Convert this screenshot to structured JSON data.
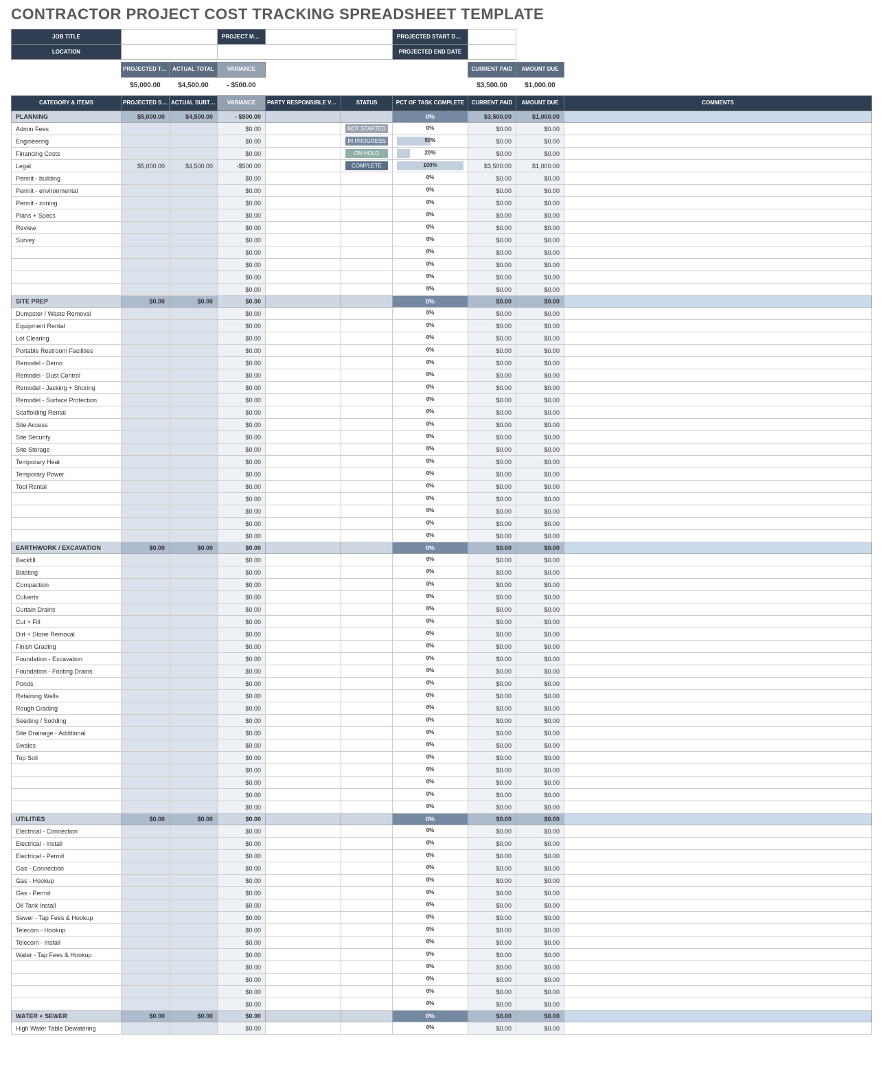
{
  "title": "CONTRACTOR PROJECT COST TRACKING SPREADSHEET TEMPLATE",
  "meta": {
    "job_title_label": "JOB TITLE",
    "location_label": "LOCATION",
    "project_mgr_label": "PROJECT MGR",
    "projected_start_label": "PROJECTED START DATE",
    "projected_end_label": "PROJECTED END DATE"
  },
  "summary_headers": {
    "projected_total": "PROJECTED\nTOTAL",
    "actual_total": "ACTUAL\nTOTAL",
    "variance": "VARIANCE",
    "current_paid": "CURRENT PAID",
    "amount_due": "AMOUNT DUE"
  },
  "summary_values": {
    "projected_total": "$5,000.00",
    "actual_total": "$4,500.00",
    "variance": "- $500.00",
    "current_paid": "$3,500.00",
    "amount_due": "$1,000.00"
  },
  "col_headers": {
    "category": "CATEGORY & ITEMS",
    "projected_subtotal": "PROJECTED\nSUBTOTAL",
    "actual_subtotal": "ACTUAL\nSUBTOTAL",
    "variance": "VARIANCE",
    "party": "PARTY RESPONSIBLE\nVendor, Contractor, etc.",
    "status": "STATUS",
    "pct": "PCT OF TASK COMPLETE",
    "current_paid": "CURRENT PAID",
    "amount_due": "AMOUNT DUE",
    "comments": "COMMENTS"
  },
  "status_labels": {
    "NOT_STARTED": "NOT STARTED",
    "IN_PROGRESS": "IN PROGRESS",
    "ON_HOLD": "ON HOLD",
    "COMPLETE": "COMPLETE"
  },
  "categories": [
    {
      "name": "PLANNING",
      "projected": "$5,000.00",
      "actual": "$4,500.00",
      "variance": "- $500.00",
      "pct": "0%",
      "paid": "$3,500.00",
      "due": "$1,000.00",
      "items": [
        {
          "name": "Admin Fees",
          "variance": "$0.00",
          "status": "NOT_STARTED",
          "pct": "0%",
          "pct_num": 0,
          "paid": "$0.00",
          "due": "$0.00"
        },
        {
          "name": "Engineering",
          "variance": "$0.00",
          "status": "IN_PROGRESS",
          "pct": "50%",
          "pct_num": 50,
          "paid": "$0.00",
          "due": "$0.00"
        },
        {
          "name": "Financing Costs",
          "variance": "$0.00",
          "status": "ON_HOLD",
          "pct": "20%",
          "pct_num": 20,
          "paid": "$0.00",
          "due": "$0.00"
        },
        {
          "name": "Legal",
          "projected": "$5,000.00",
          "actual": "$4,500.00",
          "variance": "-$500.00",
          "status": "COMPLETE",
          "pct": "100%",
          "pct_num": 100,
          "paid": "$3,500.00",
          "due": "$1,000.00"
        },
        {
          "name": "Permit - building",
          "variance": "$0.00",
          "pct": "0%",
          "pct_num": 0,
          "paid": "$0.00",
          "due": "$0.00"
        },
        {
          "name": "Permit - environmental",
          "variance": "$0.00",
          "pct": "0%",
          "pct_num": 0,
          "paid": "$0.00",
          "due": "$0.00"
        },
        {
          "name": "Permit - zoning",
          "variance": "$0.00",
          "pct": "0%",
          "pct_num": 0,
          "paid": "$0.00",
          "due": "$0.00"
        },
        {
          "name": "Plans + Specs",
          "variance": "$0.00",
          "pct": "0%",
          "pct_num": 0,
          "paid": "$0.00",
          "due": "$0.00"
        },
        {
          "name": "Review",
          "variance": "$0.00",
          "pct": "0%",
          "pct_num": 0,
          "paid": "$0.00",
          "due": "$0.00"
        },
        {
          "name": "Survey",
          "variance": "$0.00",
          "pct": "0%",
          "pct_num": 0,
          "paid": "$0.00",
          "due": "$0.00"
        },
        {
          "name": "",
          "variance": "$0.00",
          "pct": "0%",
          "pct_num": 0,
          "paid": "$0.00",
          "due": "$0.00"
        },
        {
          "name": "",
          "variance": "$0.00",
          "pct": "0%",
          "pct_num": 0,
          "paid": "$0.00",
          "due": "$0.00"
        },
        {
          "name": "",
          "variance": "$0.00",
          "pct": "0%",
          "pct_num": 0,
          "paid": "$0.00",
          "due": "$0.00"
        },
        {
          "name": "",
          "variance": "$0.00",
          "pct": "0%",
          "pct_num": 0,
          "paid": "$0.00",
          "due": "$0.00"
        }
      ]
    },
    {
      "name": "SITE PREP",
      "projected": "$0.00",
      "actual": "$0.00",
      "variance": "$0.00",
      "pct": "0%",
      "paid": "$0.00",
      "due": "$0.00",
      "items": [
        {
          "name": "Dumpster / Waste Removal",
          "variance": "$0.00",
          "pct": "0%",
          "pct_num": 0,
          "paid": "$0.00",
          "due": "$0.00"
        },
        {
          "name": "Equipment Rental",
          "variance": "$0.00",
          "pct": "0%",
          "pct_num": 0,
          "paid": "$0.00",
          "due": "$0.00"
        },
        {
          "name": "Lot Clearing",
          "variance": "$0.00",
          "pct": "0%",
          "pct_num": 0,
          "paid": "$0.00",
          "due": "$0.00"
        },
        {
          "name": "Portable Restroom Facilities",
          "variance": "$0.00",
          "pct": "0%",
          "pct_num": 0,
          "paid": "$0.00",
          "due": "$0.00"
        },
        {
          "name": "Remodel - Demo",
          "variance": "$0.00",
          "pct": "0%",
          "pct_num": 0,
          "paid": "$0.00",
          "due": "$0.00"
        },
        {
          "name": "Remodel - Dust Control",
          "variance": "$0.00",
          "pct": "0%",
          "pct_num": 0,
          "paid": "$0.00",
          "due": "$0.00"
        },
        {
          "name": "Remodel - Jacking + Shoring",
          "variance": "$0.00",
          "pct": "0%",
          "pct_num": 0,
          "paid": "$0.00",
          "due": "$0.00"
        },
        {
          "name": "Remodel - Surface Protection",
          "variance": "$0.00",
          "pct": "0%",
          "pct_num": 0,
          "paid": "$0.00",
          "due": "$0.00"
        },
        {
          "name": "Scaffolding Rental",
          "variance": "$0.00",
          "pct": "0%",
          "pct_num": 0,
          "paid": "$0.00",
          "due": "$0.00"
        },
        {
          "name": "Site Access",
          "variance": "$0.00",
          "pct": "0%",
          "pct_num": 0,
          "paid": "$0.00",
          "due": "$0.00"
        },
        {
          "name": "Site Security",
          "variance": "$0.00",
          "pct": "0%",
          "pct_num": 0,
          "paid": "$0.00",
          "due": "$0.00"
        },
        {
          "name": "Site Storage",
          "variance": "$0.00",
          "pct": "0%",
          "pct_num": 0,
          "paid": "$0.00",
          "due": "$0.00"
        },
        {
          "name": "Temporary Heat",
          "variance": "$0.00",
          "pct": "0%",
          "pct_num": 0,
          "paid": "$0.00",
          "due": "$0.00"
        },
        {
          "name": "Temporary Power",
          "variance": "$0.00",
          "pct": "0%",
          "pct_num": 0,
          "paid": "$0.00",
          "due": "$0.00"
        },
        {
          "name": "Tool Rental",
          "variance": "$0.00",
          "pct": "0%",
          "pct_num": 0,
          "paid": "$0.00",
          "due": "$0.00"
        },
        {
          "name": "",
          "variance": "$0.00",
          "pct": "0%",
          "pct_num": 0,
          "paid": "$0.00",
          "due": "$0.00"
        },
        {
          "name": "",
          "variance": "$0.00",
          "pct": "0%",
          "pct_num": 0,
          "paid": "$0.00",
          "due": "$0.00"
        },
        {
          "name": "",
          "variance": "$0.00",
          "pct": "0%",
          "pct_num": 0,
          "paid": "$0.00",
          "due": "$0.00"
        },
        {
          "name": "",
          "variance": "$0.00",
          "pct": "0%",
          "pct_num": 0,
          "paid": "$0.00",
          "due": "$0.00"
        }
      ]
    },
    {
      "name": "EARTHWORK / EXCAVATION",
      "projected": "$0.00",
      "actual": "$0.00",
      "variance": "$0.00",
      "pct": "0%",
      "paid": "$0.00",
      "due": "$0.00",
      "items": [
        {
          "name": "Backfill",
          "variance": "$0.00",
          "pct": "0%",
          "pct_num": 0,
          "paid": "$0.00",
          "due": "$0.00"
        },
        {
          "name": "Blasting",
          "variance": "$0.00",
          "pct": "0%",
          "pct_num": 0,
          "paid": "$0.00",
          "due": "$0.00"
        },
        {
          "name": "Compaction",
          "variance": "$0.00",
          "pct": "0%",
          "pct_num": 0,
          "paid": "$0.00",
          "due": "$0.00"
        },
        {
          "name": "Culverts",
          "variance": "$0.00",
          "pct": "0%",
          "pct_num": 0,
          "paid": "$0.00",
          "due": "$0.00"
        },
        {
          "name": "Curtain Drains",
          "variance": "$0.00",
          "pct": "0%",
          "pct_num": 0,
          "paid": "$0.00",
          "due": "$0.00"
        },
        {
          "name": "Cut + Fill",
          "variance": "$0.00",
          "pct": "0%",
          "pct_num": 0,
          "paid": "$0.00",
          "due": "$0.00"
        },
        {
          "name": "Dirt + Stone Removal",
          "variance": "$0.00",
          "pct": "0%",
          "pct_num": 0,
          "paid": "$0.00",
          "due": "$0.00"
        },
        {
          "name": "Finish Grading",
          "variance": "$0.00",
          "pct": "0%",
          "pct_num": 0,
          "paid": "$0.00",
          "due": "$0.00"
        },
        {
          "name": "Foundation - Excavation",
          "variance": "$0.00",
          "pct": "0%",
          "pct_num": 0,
          "paid": "$0.00",
          "due": "$0.00"
        },
        {
          "name": "Foundation - Footing Drains",
          "variance": "$0.00",
          "pct": "0%",
          "pct_num": 0,
          "paid": "$0.00",
          "due": "$0.00"
        },
        {
          "name": "Ponds",
          "variance": "$0.00",
          "pct": "0%",
          "pct_num": 0,
          "paid": "$0.00",
          "due": "$0.00"
        },
        {
          "name": "Retaining Walls",
          "variance": "$0.00",
          "pct": "0%",
          "pct_num": 0,
          "paid": "$0.00",
          "due": "$0.00"
        },
        {
          "name": "Rough Grading",
          "variance": "$0.00",
          "pct": "0%",
          "pct_num": 0,
          "paid": "$0.00",
          "due": "$0.00"
        },
        {
          "name": "Seeding / Sodding",
          "variance": "$0.00",
          "pct": "0%",
          "pct_num": 0,
          "paid": "$0.00",
          "due": "$0.00"
        },
        {
          "name": "Site Drainage - Additional",
          "variance": "$0.00",
          "pct": "0%",
          "pct_num": 0,
          "paid": "$0.00",
          "due": "$0.00"
        },
        {
          "name": "Swales",
          "variance": "$0.00",
          "pct": "0%",
          "pct_num": 0,
          "paid": "$0.00",
          "due": "$0.00"
        },
        {
          "name": "Top Soil",
          "variance": "$0.00",
          "pct": "0%",
          "pct_num": 0,
          "paid": "$0.00",
          "due": "$0.00"
        },
        {
          "name": "",
          "variance": "$0.00",
          "pct": "0%",
          "pct_num": 0,
          "paid": "$0.00",
          "due": "$0.00"
        },
        {
          "name": "",
          "variance": "$0.00",
          "pct": "0%",
          "pct_num": 0,
          "paid": "$0.00",
          "due": "$0.00"
        },
        {
          "name": "",
          "variance": "$0.00",
          "pct": "0%",
          "pct_num": 0,
          "paid": "$0.00",
          "due": "$0.00"
        },
        {
          "name": "",
          "variance": "$0.00",
          "pct": "0%",
          "pct_num": 0,
          "paid": "$0.00",
          "due": "$0.00"
        }
      ]
    },
    {
      "name": "UTILITIES",
      "projected": "$0.00",
      "actual": "$0.00",
      "variance": "$0.00",
      "pct": "0%",
      "paid": "$0.00",
      "due": "$0.00",
      "items": [
        {
          "name": "Electrical - Connection",
          "variance": "$0.00",
          "pct": "0%",
          "pct_num": 0,
          "paid": "$0.00",
          "due": "$0.00"
        },
        {
          "name": "Electrical - Install",
          "variance": "$0.00",
          "pct": "0%",
          "pct_num": 0,
          "paid": "$0.00",
          "due": "$0.00"
        },
        {
          "name": "Electrical - Permit",
          "variance": "$0.00",
          "pct": "0%",
          "pct_num": 0,
          "paid": "$0.00",
          "due": "$0.00"
        },
        {
          "name": "Gas - Connection",
          "variance": "$0.00",
          "pct": "0%",
          "pct_num": 0,
          "paid": "$0.00",
          "due": "$0.00"
        },
        {
          "name": "Gas - Hookup",
          "variance": "$0.00",
          "pct": "0%",
          "pct_num": 0,
          "paid": "$0.00",
          "due": "$0.00"
        },
        {
          "name": "Gas - Permit",
          "variance": "$0.00",
          "pct": "0%",
          "pct_num": 0,
          "paid": "$0.00",
          "due": "$0.00"
        },
        {
          "name": "Oil Tank Install",
          "variance": "$0.00",
          "pct": "0%",
          "pct_num": 0,
          "paid": "$0.00",
          "due": "$0.00"
        },
        {
          "name": "Sewer - Tap Fees & Hookup",
          "variance": "$0.00",
          "pct": "0%",
          "pct_num": 0,
          "paid": "$0.00",
          "due": "$0.00"
        },
        {
          "name": "Telecom - Hookup",
          "variance": "$0.00",
          "pct": "0%",
          "pct_num": 0,
          "paid": "$0.00",
          "due": "$0.00"
        },
        {
          "name": "Telecom - Install",
          "variance": "$0.00",
          "pct": "0%",
          "pct_num": 0,
          "paid": "$0.00",
          "due": "$0.00"
        },
        {
          "name": "Water - Tap Fees & Hookup",
          "variance": "$0.00",
          "pct": "0%",
          "pct_num": 0,
          "paid": "$0.00",
          "due": "$0.00"
        },
        {
          "name": "",
          "variance": "$0.00",
          "pct": "0%",
          "pct_num": 0,
          "paid": "$0.00",
          "due": "$0.00"
        },
        {
          "name": "",
          "variance": "$0.00",
          "pct": "0%",
          "pct_num": 0,
          "paid": "$0.00",
          "due": "$0.00"
        },
        {
          "name": "",
          "variance": "$0.00",
          "pct": "0%",
          "pct_num": 0,
          "paid": "$0.00",
          "due": "$0.00"
        },
        {
          "name": "",
          "variance": "$0.00",
          "pct": "0%",
          "pct_num": 0,
          "paid": "$0.00",
          "due": "$0.00"
        }
      ]
    },
    {
      "name": "WATER + SEWER",
      "projected": "$0.00",
      "actual": "$0.00",
      "variance": "$0.00",
      "pct": "0%",
      "paid": "$0.00",
      "due": "$0.00",
      "items": [
        {
          "name": "High Water Table Dewatering",
          "variance": "$0.00",
          "pct": "0%",
          "pct_num": 0,
          "paid": "$0.00",
          "due": "$0.00"
        }
      ]
    }
  ]
}
